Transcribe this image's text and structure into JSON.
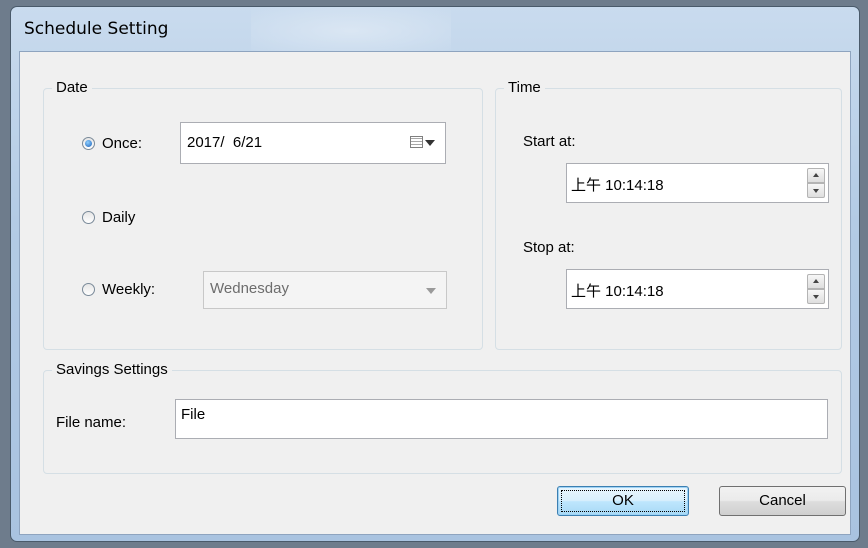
{
  "window": {
    "title": "Schedule Setting"
  },
  "date_group": {
    "label": "Date",
    "once_label": "Once:",
    "once_date": "2017/  6/21",
    "daily_label": "Daily",
    "weekly_label": "Weekly:",
    "weekly_value": "Wednesday",
    "selected": "once"
  },
  "time_group": {
    "label": "Time",
    "start_label": "Start at:",
    "start_value": "上午 10:14:18",
    "stop_label": "Stop at:",
    "stop_value": "上午 10:14:18"
  },
  "savings_group": {
    "label": "Savings Settings",
    "file_name_label": "File name:",
    "file_name_value": "File"
  },
  "buttons": {
    "ok": "OK",
    "cancel": "Cancel"
  },
  "icons": [
    "calendar-icon",
    "dropdown-arrow-icon",
    "spin-up-icon",
    "spin-down-icon"
  ],
  "colors": {
    "radio_selected": "#1b5fb8",
    "default_button_border": "#3c7fb1"
  }
}
